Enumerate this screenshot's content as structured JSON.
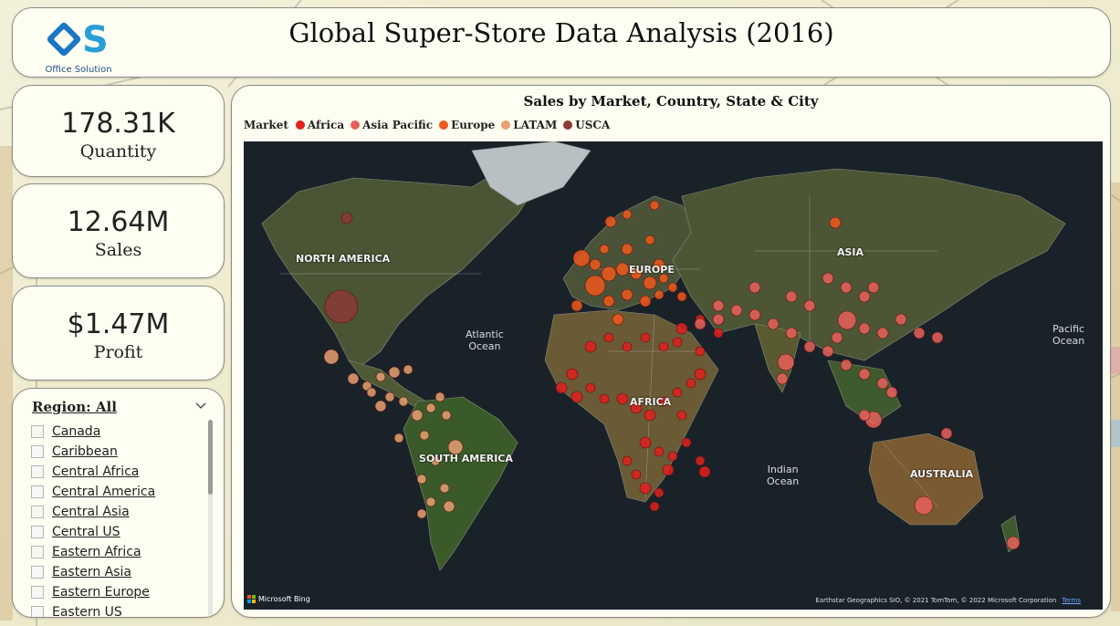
{
  "header": {
    "title": "Global Super-Store Data Analysis (2016)",
    "logo_text": "Office Solution"
  },
  "kpis": {
    "quantity": {
      "value": "178.31K",
      "label": "Quantity"
    },
    "sales": {
      "value": "12.64M",
      "label": "Sales"
    },
    "profit": {
      "value": "$1.47M",
      "label": "Profit"
    }
  },
  "slicer": {
    "header": "Region: All",
    "items": [
      {
        "label": "Canada",
        "checked": false
      },
      {
        "label": "Caribbean",
        "checked": false
      },
      {
        "label": "Central Africa",
        "checked": false
      },
      {
        "label": "Central America",
        "checked": false
      },
      {
        "label": "Central Asia",
        "checked": false
      },
      {
        "label": "Central US",
        "checked": false
      },
      {
        "label": "Eastern Africa",
        "checked": false
      },
      {
        "label": "Eastern Asia",
        "checked": false
      },
      {
        "label": "Eastern Europe",
        "checked": false
      },
      {
        "label": "Eastern US",
        "checked": false
      }
    ]
  },
  "map": {
    "title": "Sales by Market, Country, State & City",
    "legend_title": "Market",
    "legend": [
      {
        "label": "Africa",
        "color": "#e0201c"
      },
      {
        "label": "Asia Pacific",
        "color": "#e8605a"
      },
      {
        "label": "Europe",
        "color": "#f0581c"
      },
      {
        "label": "LATAM",
        "color": "#e8a070"
      },
      {
        "label": "USCA",
        "color": "#8b3a36"
      }
    ],
    "region_labels": {
      "north_america": "NORTH AMERICA",
      "europe": "EUROPE",
      "asia": "ASIA",
      "africa": "AFRICA",
      "south_america": "SOUTH AMERICA",
      "australia": "AUSTRALIA"
    },
    "ocean_labels": {
      "atlantic": "Atlantic\nOcean",
      "pacific": "Pacific\nOcean",
      "indian": "Indian\nOcean"
    },
    "bing_text": "Microsoft Bing",
    "attribution": "Earthstar Geographics SIO, © 2021 TomTom, © 2022 Microsoft Corporation",
    "terms_link": "Terms"
  }
}
